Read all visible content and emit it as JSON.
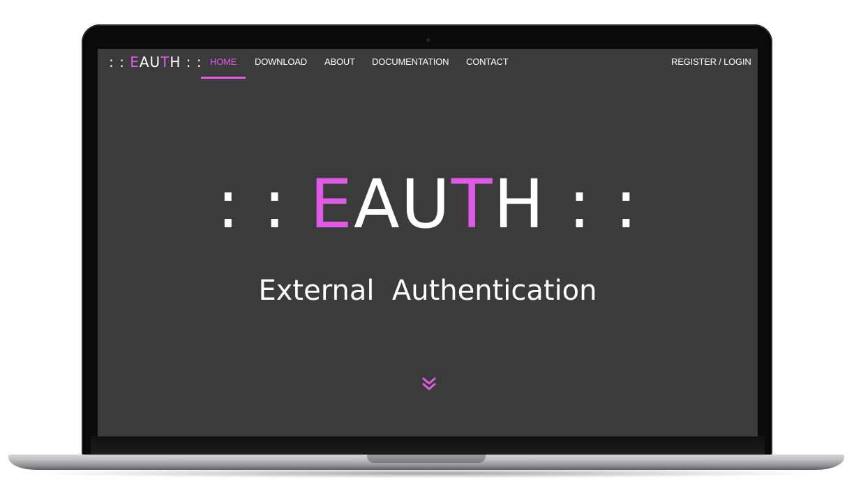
{
  "logo": {
    "prefix": ": : ",
    "e": "E",
    "au": "AU",
    "t": "T",
    "h": "H",
    "suffix": " : :"
  },
  "nav": {
    "items": [
      {
        "label": "HOME",
        "active": true
      },
      {
        "label": "DOWNLOAD",
        "active": false
      },
      {
        "label": "ABOUT",
        "active": false
      },
      {
        "label": "DOCUMENTATION",
        "active": false
      },
      {
        "label": "CONTACT",
        "active": false
      }
    ],
    "register_login": "REGISTER / LOGIN"
  },
  "hero": {
    "title_prefix": ": : ",
    "title_e": "E",
    "title_au": "AU",
    "title_t": "T",
    "title_h": "H",
    "title_suffix": " : :",
    "subtitle": "External  Authentication",
    "scroll_icon": "double-chevron-down-icon"
  },
  "colors": {
    "accent": "#e05ae8",
    "background": "#3b3b3c",
    "text": "#ffffff"
  }
}
